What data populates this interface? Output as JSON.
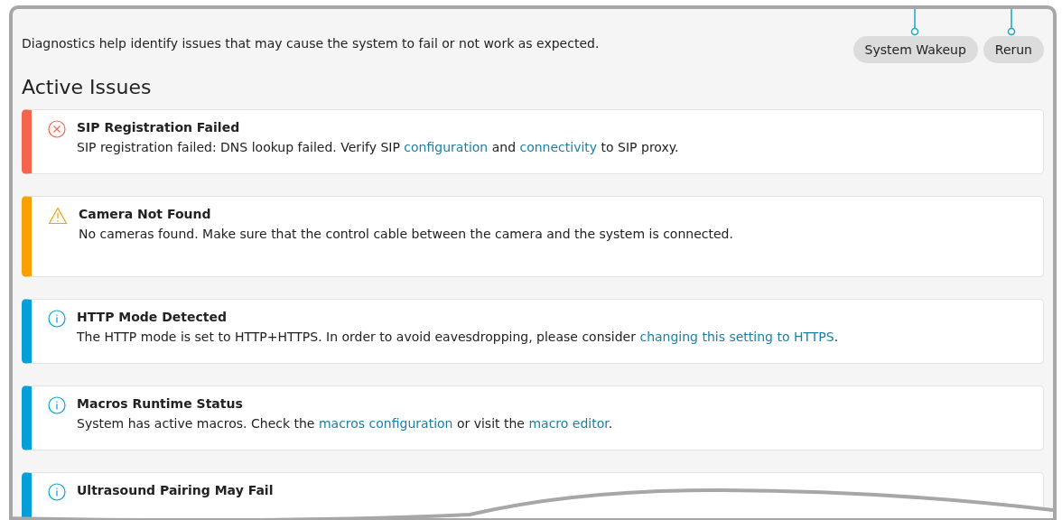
{
  "intro": "Diagnostics help identify issues that may cause the system to fail or not work as expected.",
  "buttons": [
    "System Wakeup",
    "Rerun"
  ],
  "heading": "Active Issues",
  "issues": [
    {
      "kind": "error",
      "title": "SIP Registration Failed",
      "description": [
        {
          "kind": "text",
          "text": "SIP registration failed: DNS lookup failed. Verify SIP "
        },
        {
          "kind": "link",
          "text": "configuration"
        },
        {
          "kind": "text",
          "text": " and "
        },
        {
          "kind": "link",
          "text": "connectivity"
        },
        {
          "kind": "text",
          "text": " to SIP proxy."
        }
      ]
    },
    {
      "kind": "warning",
      "title": "Camera Not Found",
      "description": [
        {
          "kind": "text",
          "text": "No cameras found. Make sure that the control cable between the camera and the system is connected."
        }
      ]
    },
    {
      "kind": "info",
      "title": "HTTP Mode Detected",
      "description": [
        {
          "kind": "text",
          "text": "The HTTP mode is set to HTTP+HTTPS. In order to avoid eavesdropping, please consider "
        },
        {
          "kind": "link",
          "text": "changing this setting to HTTPS"
        },
        {
          "kind": "text",
          "text": "."
        }
      ]
    },
    {
      "kind": "info",
      "title": "Macros Runtime Status",
      "description": [
        {
          "kind": "text",
          "text": "System has active macros. Check the "
        },
        {
          "kind": "link",
          "text": "macros configuration"
        },
        {
          "kind": "text",
          "text": " or visit the "
        },
        {
          "kind": "link",
          "text": "macro editor"
        },
        {
          "kind": "text",
          "text": "."
        }
      ]
    },
    {
      "kind": "info",
      "title": "Ultrasound Pairing May Fail"
    }
  ]
}
